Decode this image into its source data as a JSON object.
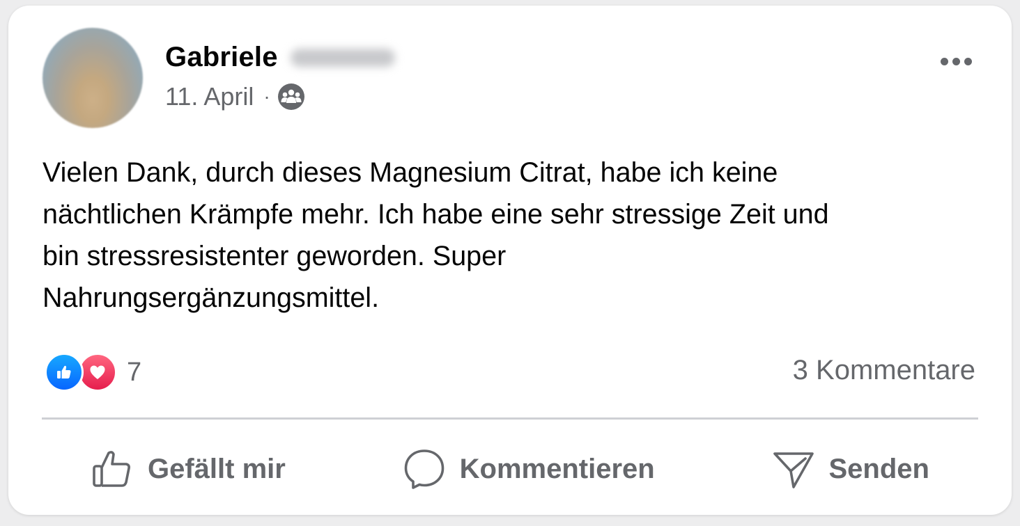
{
  "post": {
    "author_name": "Gabriele",
    "date": "11. April",
    "separator": "·",
    "audience_icon": "group-icon",
    "more_icon": "more-options-icon",
    "text": "Vielen Dank, durch dieses Magnesium Citrat, habe ich keine\nnächtlichen Krämpfe mehr. Ich habe eine sehr stressige Zeit und\nbin stressresistenter geworden. Super\nNahrungsergänzungsmittel."
  },
  "reactions": {
    "types": [
      "like-icon",
      "love-icon"
    ],
    "count": "7"
  },
  "comments": {
    "label": "3 Kommentare"
  },
  "actions": {
    "like": "Gefällt mir",
    "comment": "Kommentieren",
    "send": "Senden"
  },
  "colors": {
    "like_blue": "#0866ff",
    "love_red": "#e61e4d",
    "secondary_text": "#65676b",
    "primary_text": "#050505"
  }
}
